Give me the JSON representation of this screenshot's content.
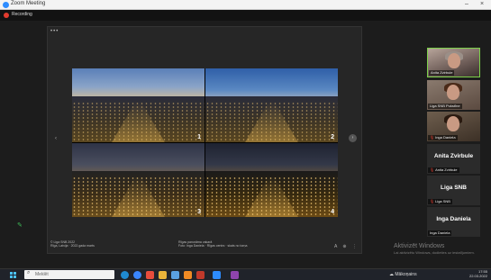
{
  "window": {
    "title": "Zoom Meeting",
    "minimize": "–",
    "close": "×"
  },
  "recording": {
    "label": "Recording"
  },
  "share": {
    "dots": "•••",
    "quadrants": [
      {
        "number": "1"
      },
      {
        "number": "2"
      },
      {
        "number": "3"
      },
      {
        "number": "4"
      }
    ],
    "nav_left": "‹",
    "nav_right": "›",
    "caption_left_line1": "© Liga SNB 2022",
    "caption_left_line2": "Rīga, Latvija · 2022.gada marts",
    "caption_mid_line1": "Rīgas panorāma vakarā",
    "caption_mid_line2": "Foto: Inga Daniela · Rīgas centrs · skats no torņa",
    "ctrl_a": "A",
    "ctrl_b": "⊕",
    "ctrl_c": "⋮"
  },
  "participants": [
    {
      "name": "Anita Zvirbule",
      "type": "video",
      "active": true
    },
    {
      "name": "Liga SNB Pukstīne",
      "type": "video"
    },
    {
      "name": "Inga Daniela",
      "type": "video"
    },
    {
      "big_name": "Anita Zvirbule",
      "name": "Anita Zvirbule",
      "type": "name"
    },
    {
      "big_name": "Liga SNB",
      "name": "Liga SNB",
      "type": "name"
    },
    {
      "big_name": "Inga Daniela",
      "name": "Inga Daniela",
      "type": "name"
    }
  ],
  "watermark": {
    "title": "Aktivizēt Windows",
    "subtitle": "Lai aktivizētu Windows, dodieties uz iestatījumiem."
  },
  "taskbar": {
    "search_placeholder": "Meklēt",
    "weather": "☁ Mākoņains",
    "time": "17:55",
    "date": "22.03.2022"
  }
}
